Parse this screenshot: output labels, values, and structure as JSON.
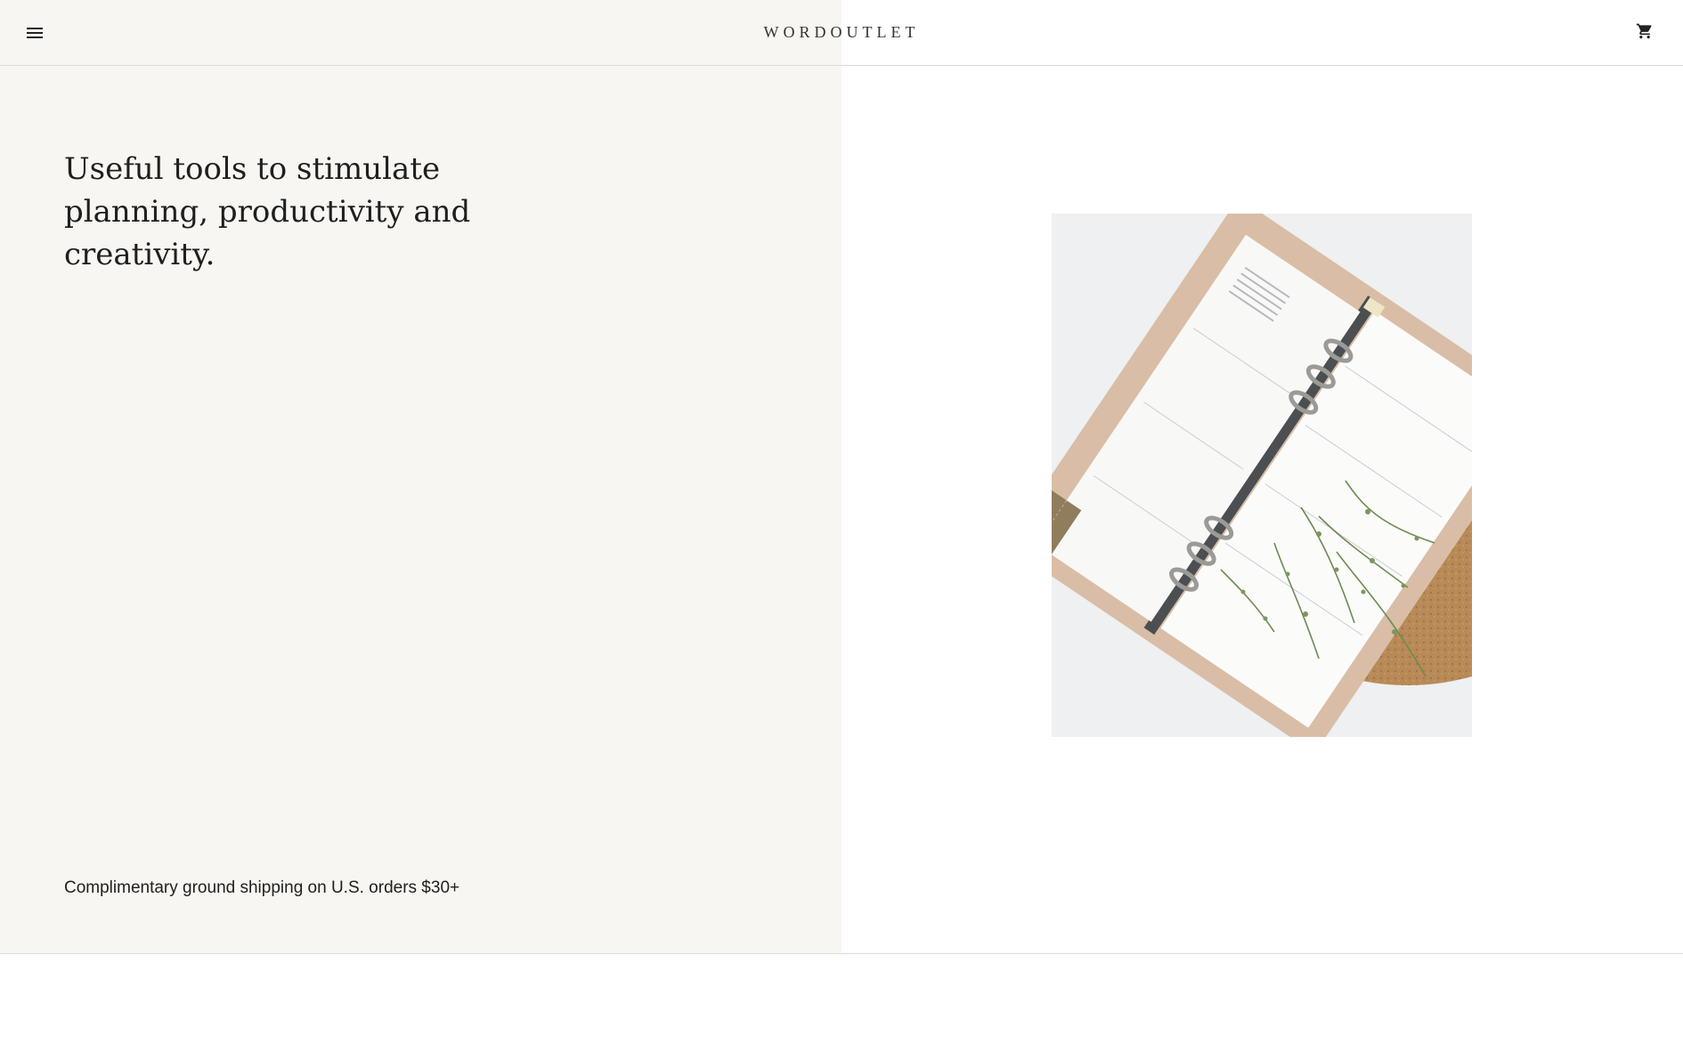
{
  "header": {
    "logo": "WORDOUTLET",
    "menu_icon": "hamburger-menu-icon",
    "cart_icon": "shopping-cart-icon"
  },
  "hero": {
    "headline": "Useful tools to stimulate planning, productivity and creativity.",
    "shipping_note": "Complimentary ground shipping on U.S. orders $30+",
    "image_alt": "Planner with leather cover and small plant on cork"
  },
  "colors": {
    "left_panel_bg": "#f7f6f2",
    "right_panel_bg": "#ffffff",
    "divider": "#dddbd6",
    "text": "#1f1f1f"
  }
}
